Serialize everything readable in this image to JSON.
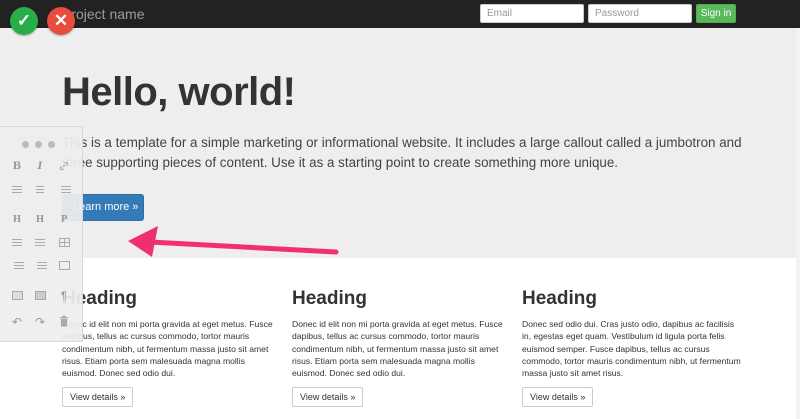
{
  "navbar": {
    "brand": "Project name",
    "email_placeholder": "Email",
    "password_placeholder": "Password",
    "signin_label": "Sign in"
  },
  "overlay": {
    "ok_icon": "check-icon",
    "cancel_icon": "close-icon"
  },
  "jumbotron": {
    "title": "Hello, world!",
    "text": "This is a template for a simple marketing or informational website. It includes a large callout called a jumbotron and three supporting pieces of content. Use it as a starting point to create something more unique.",
    "button_label": "Learn more »"
  },
  "columns": [
    {
      "heading": "Heading",
      "text": "Donec id elit non mi porta gravida at eget metus. Fusce dapibus, tellus ac cursus commodo, tortor mauris condimentum nibh, ut fermentum massa justo sit amet risus. Etiam porta sem malesuada magna mollis euismod. Donec sed odio dui.",
      "button_label": "View details »"
    },
    {
      "heading": "Heading",
      "text": "Donec id elit non mi porta gravida at eget metus. Fusce dapibus, tellus ac cursus commodo, tortor mauris condimentum nibh, ut fermentum massa justo sit amet risus. Etiam porta sem malesuada magna mollis euismod. Donec sed odio dui.",
      "button_label": "View details »"
    },
    {
      "heading": "Heading",
      "text": "Donec sed odio dui. Cras justo odio, dapibus ac facilisis in, egestas eget quam. Vestibulum id ligula porta felis euismod semper. Fusce dapibus, tellus ac cursus commodo, tortor mauris condimentum nibh, ut fermentum massa justo sit amet risus.",
      "button_label": "View details »"
    }
  ],
  "toolbar": {
    "bold": "B",
    "italic": "I",
    "heading1": "H",
    "heading2": "H",
    "paragraph": "P",
    "icons": [
      "bold-icon",
      "italic-icon",
      "link-icon",
      "align-left-icon",
      "align-center-icon",
      "align-right-icon",
      "heading1-icon",
      "heading2-icon",
      "paragraph-icon",
      "bullet-list-icon",
      "numbered-list-icon",
      "table-icon",
      "indent-icon",
      "outdent-icon",
      "insert-block-icon",
      "image-icon",
      "video-icon",
      "pilcrow-icon",
      "undo-icon",
      "redo-icon",
      "trash-icon"
    ]
  },
  "colors": {
    "arrow": "#f0306e",
    "ok": "#27ae48",
    "cancel": "#e74c3c",
    "primary": "#337ab7",
    "success": "#5cb85c"
  }
}
